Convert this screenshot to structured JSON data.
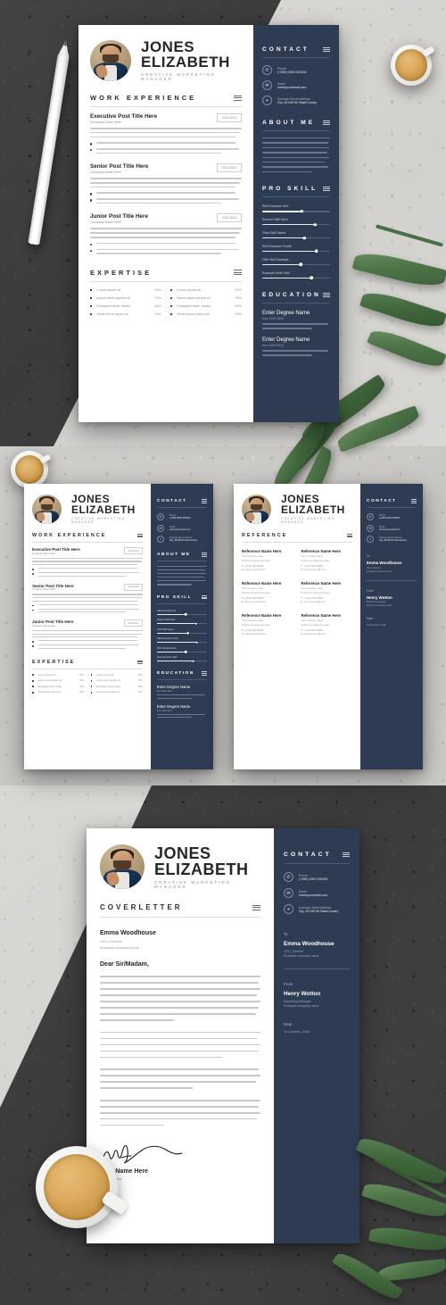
{
  "person": {
    "first_name": "JONES",
    "last_name": "ELIZABETH",
    "role": "CREATIVE MARKETING MANAGER"
  },
  "sections": {
    "work_experience": "WORK EXPERIENCE",
    "expertise": "EXPERTISE",
    "contact": "CONTACT",
    "about_me": "ABOUT ME",
    "pro_skill": "PRO SKILL",
    "education": "EDUCATION",
    "reference": "REFERENCE",
    "coverletter": "COVERLETTER"
  },
  "jobs": [
    {
      "title": "Executive Post Title Here",
      "company": "Company Name Here",
      "date": "2010-2014"
    },
    {
      "title": "Senior Post Title Here",
      "company": "Company Name Here",
      "date": "2010-2014"
    },
    {
      "title": "Junior Post Title Here",
      "company": "Company Name Here",
      "date": "2010-2014"
    }
  ],
  "job_body": "Lorem ametion nim eserum, que nihicum fugitae moior aut quiaepre omnis distod sin dus tin et est, conquodite ed ut en mollesdonem conqatat audanda niend modupto, aut offic tic sunt tit aut optatur morditi ut quostionam qui velis eum quiam sa struati",
  "job_bullets": [
    "Exemple minctione nim exerum, que nihicum fugitae moior aut quiaepre",
    "distod sin dus tin et est, conquodite ed ut omnisdonorem conqatat audianda niend modupta remus aut offic tic sunt tit est optatur morditi ut"
  ],
  "expertise": {
    "left": [
      {
        "label": "Lorem ipsum sit",
        "pct": "90%"
      },
      {
        "label": "Ipsum amet aquam sit",
        "pct": "75%"
      },
      {
        "label": "Examples facer medio",
        "pct": "68%"
      },
      {
        "label": "Amet lorem ipsum sit",
        "pct": "49%"
      }
    ],
    "right": [
      {
        "label": "Lorem ipsum sit",
        "pct": "90%"
      },
      {
        "label": "Ipsum amet aquam sit",
        "pct": "75%"
      },
      {
        "label": "Examples facer medio",
        "pct": "68%"
      },
      {
        "label": "Amet ipsum ipsum sit",
        "pct": "49%"
      }
    ]
  },
  "contact": [
    {
      "icon": "phone-icon",
      "label": "Phone",
      "value": "(+450) 0000 000000"
    },
    {
      "icon": "envelope-icon",
      "label": "Email",
      "value": "loremyouremail.com"
    },
    {
      "icon": "pin-icon",
      "label": "Example Street Address",
      "value": "City, 45748745 State/Country"
    }
  ],
  "about_me": "Lorem minctione nim exerum, que nihic sunt fugitae moior aut quiaepre omnis distod sereduntin sint modupte emnis dolo qui offic tic sunt tit aut optatur morditi ut quostiontam qui odis eum quam sa docte in emis et atque remund ni",
  "skills": [
    {
      "label": "Skill Example One",
      "value": 58
    },
    {
      "label": "Second Skill Here",
      "value": 78
    },
    {
      "label": "Third Skill Name",
      "value": 62
    },
    {
      "label": "Skill Example Fourth",
      "value": 80
    },
    {
      "label": "Fifth Skill Example",
      "value": 57
    },
    {
      "label": "Example Sixth Skill",
      "value": 73
    }
  ],
  "education": [
    {
      "degree": "Enter Degree Name",
      "years": "from 2010-2014",
      "desc": "Example orem ipsum docn ut ut aquam emet facer"
    },
    {
      "degree": "Enter Degree Name",
      "years": "from 2010-2014",
      "desc": "Example orem ipsum docn ut ut aquam emet facer"
    }
  ],
  "reference": {
    "items": [
      {
        "name": "Reference Name Here",
        "company": "Your company name",
        "position": "Position at reference name",
        "phone": "P: (+440) 000 85890",
        "email": "E: loremyouremail.com"
      },
      {
        "name": "Reference Name Here",
        "company": "Your company name",
        "position": "Position at reference name",
        "phone": "P: (+440) 000 85890",
        "email": "E: loremyouremail.com"
      },
      {
        "name": "Reference Name Here",
        "company": "Your company name",
        "position": "Position at reference name",
        "phone": "P: (+440) 000 85890",
        "email": "E: loremyouremail.com"
      },
      {
        "name": "Reference Name Here",
        "company": "Your company name",
        "position": "Position at reference name",
        "phone": "P: (+440) 000 85890",
        "email": "E: loremyouremail.com"
      },
      {
        "name": "Reference Name Here",
        "company": "Your company name",
        "position": "Position at reference name",
        "phone": "P: (+440) 000 85890",
        "email": "E: loremyouremail.com"
      },
      {
        "name": "Reference Name Here",
        "company": "Your company name",
        "position": "Position at reference name",
        "phone": "P: (+440) 000 85890",
        "email": "E: loremyouremail.com"
      }
    ]
  },
  "letter_meta": {
    "to_label": "To",
    "to_name": "Emma Woodhouse",
    "to_role": "CEO, Director",
    "to_company": "Example company name",
    "from_label": "From",
    "from_name": "Henry Wotton",
    "from_role": "Marketing Manager",
    "from_company": "Example company name",
    "date_label": "Date :",
    "date_value": "12 October, 2018"
  },
  "coverletter": {
    "recipient_name": "Emma Woodhouse",
    "recipient_role": "CEO, Director",
    "recipient_company": "Example company name",
    "salutation": "Dear Sir/Madam,",
    "signoff_name": "Your Name Here",
    "signoff_role": "CEO, Director",
    "paragraphs": [
      "Lorem ipsum dolor sit amet consectetuer odio non tellus nateque accumsan. Sed hac enim Lorem tempus tortor justo eget scelerisque sed eros am morbi. Egestas eros quis apien eu nunc Pellentesque Nulla Aenean congue magna. Nibh felis Mo rbi id lacula Vestibulum tincidunt turpisluts sem magna Nam tellus laoreet molestie Curabitur lorem Proin. Senectus urna Vestibulum tincidunt turpis sem magna Nam hendrit ulutae nec amet nibh Nam tellus laoreet molestie Curabitur lorem Proin exempel ipsum.",
      "Curabitur Maecenas orci. Tincidunt adipiscing nisl et et ac tincidunt elit nulla mau res eleifend. Urna. Quis ante odio consectet uer interdum aquam dolor natoque Nam libero mollis euismod lacus ut velit tellus malesuada velit curabitur quis semper egestas eros accumsan dolor aquam.",
      "eleifend. Urna. Quis ante odio consectet uer interdum aquam dolor natoque Nam libero mollis. euismod lacus ut velit tellus malesuada velit curabitur quis semper emper pretium example consectetuer aquam.",
      "ateque Nulla Aenean congue magna. Penatibus lacus loc elit semper tempor arcu Sed dui non Malesuada felis Aenean congue magna. Donec sem pretium example consectetuer pellentesque senectus consectetuer aspen lorem ipsum simple dummy text of printing and typesetting facer modo."
    ]
  }
}
